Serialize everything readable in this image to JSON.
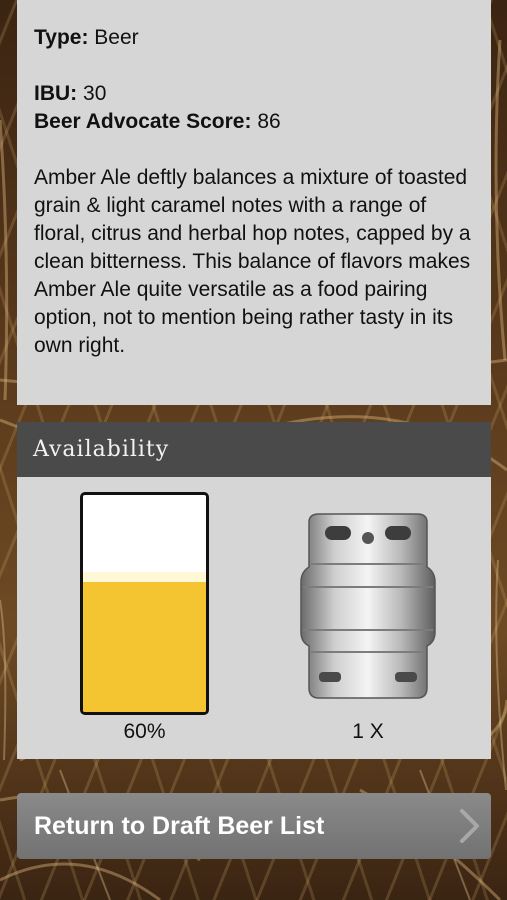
{
  "beer": {
    "type_label": "Type:",
    "type_value": "Beer",
    "ibu_label": "IBU:",
    "ibu_value": "30",
    "score_label": "Beer Advocate Score:",
    "score_value": "86",
    "description": "Amber Ale deftly balances a mixture of toasted grain & light caramel notes with a range of floral, citrus and herbal hop notes, capped by a clean bitterness. This balance of flavors makes Amber Ale quite versatile as a food pairing option, not to mention being rather tasty in its own right."
  },
  "availability": {
    "title": "Availability",
    "fill_fraction": 0.6,
    "percent_text": "60%",
    "keg_count_text": "1 X",
    "colors": {
      "beer": "#f5c431",
      "foam": "#fff7d6"
    }
  },
  "nav": {
    "return_label": "Return to Draft Beer List"
  },
  "icons": [
    "keg-icon",
    "chevron-right-icon"
  ]
}
